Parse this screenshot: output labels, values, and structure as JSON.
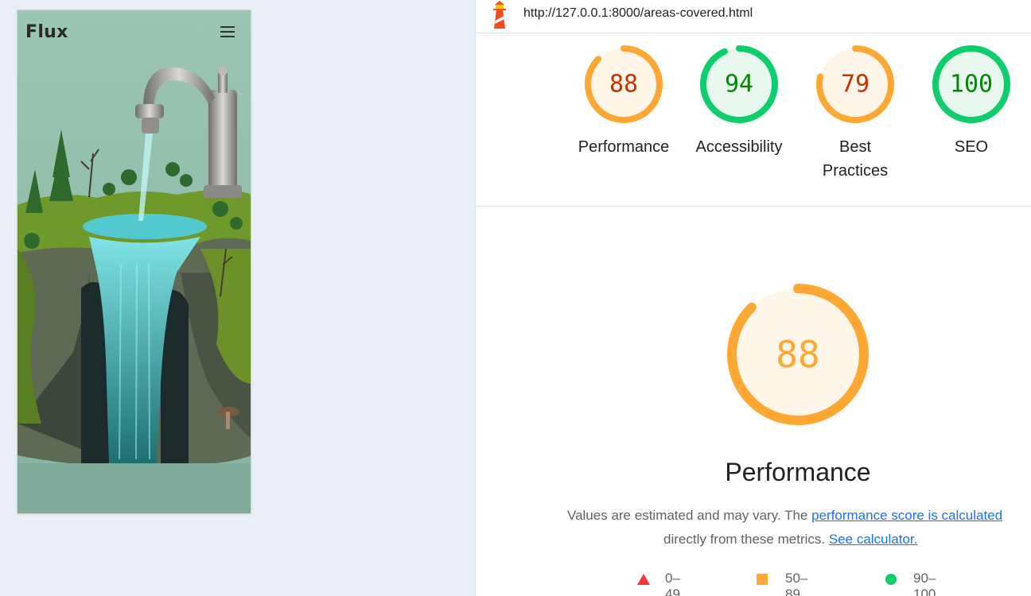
{
  "preview": {
    "brand": "Flux"
  },
  "report": {
    "url": "http://127.0.0.1:8000/areas-covered.html",
    "gauges": [
      {
        "label": "Performance",
        "score": "88",
        "value": 0.88,
        "status": "average"
      },
      {
        "label": "Accessibility",
        "score": "94",
        "value": 0.94,
        "status": "pass"
      },
      {
        "label": "Best Practices",
        "score": "79",
        "value": 0.79,
        "status": "average"
      },
      {
        "label": "SEO",
        "score": "100",
        "value": 1.0,
        "status": "pass"
      }
    ],
    "main": {
      "score": "88",
      "value": 0.88,
      "title": "Performance",
      "desc_prefix": "Values are estimated and may vary. The",
      "desc_link1": "performance score is calculated",
      "desc_middle": "directly from these metrics.",
      "desc_link2": "See calculator."
    },
    "legend": [
      {
        "label": "0–49",
        "shape": "triangle",
        "color": "#ff3333"
      },
      {
        "label": "50–89",
        "shape": "square",
        "color": "#ffaa33"
      },
      {
        "label": "90–100",
        "shape": "circle",
        "color": "#0cce6b"
      }
    ]
  },
  "colors": {
    "average_stroke": "#ffa733",
    "average_text": "#c33300",
    "average_fill": "#fff6ea",
    "pass_stroke": "#0cce6b",
    "pass_text": "#008800",
    "pass_fill": "#e8f8ee",
    "link": "#1a73e8"
  }
}
